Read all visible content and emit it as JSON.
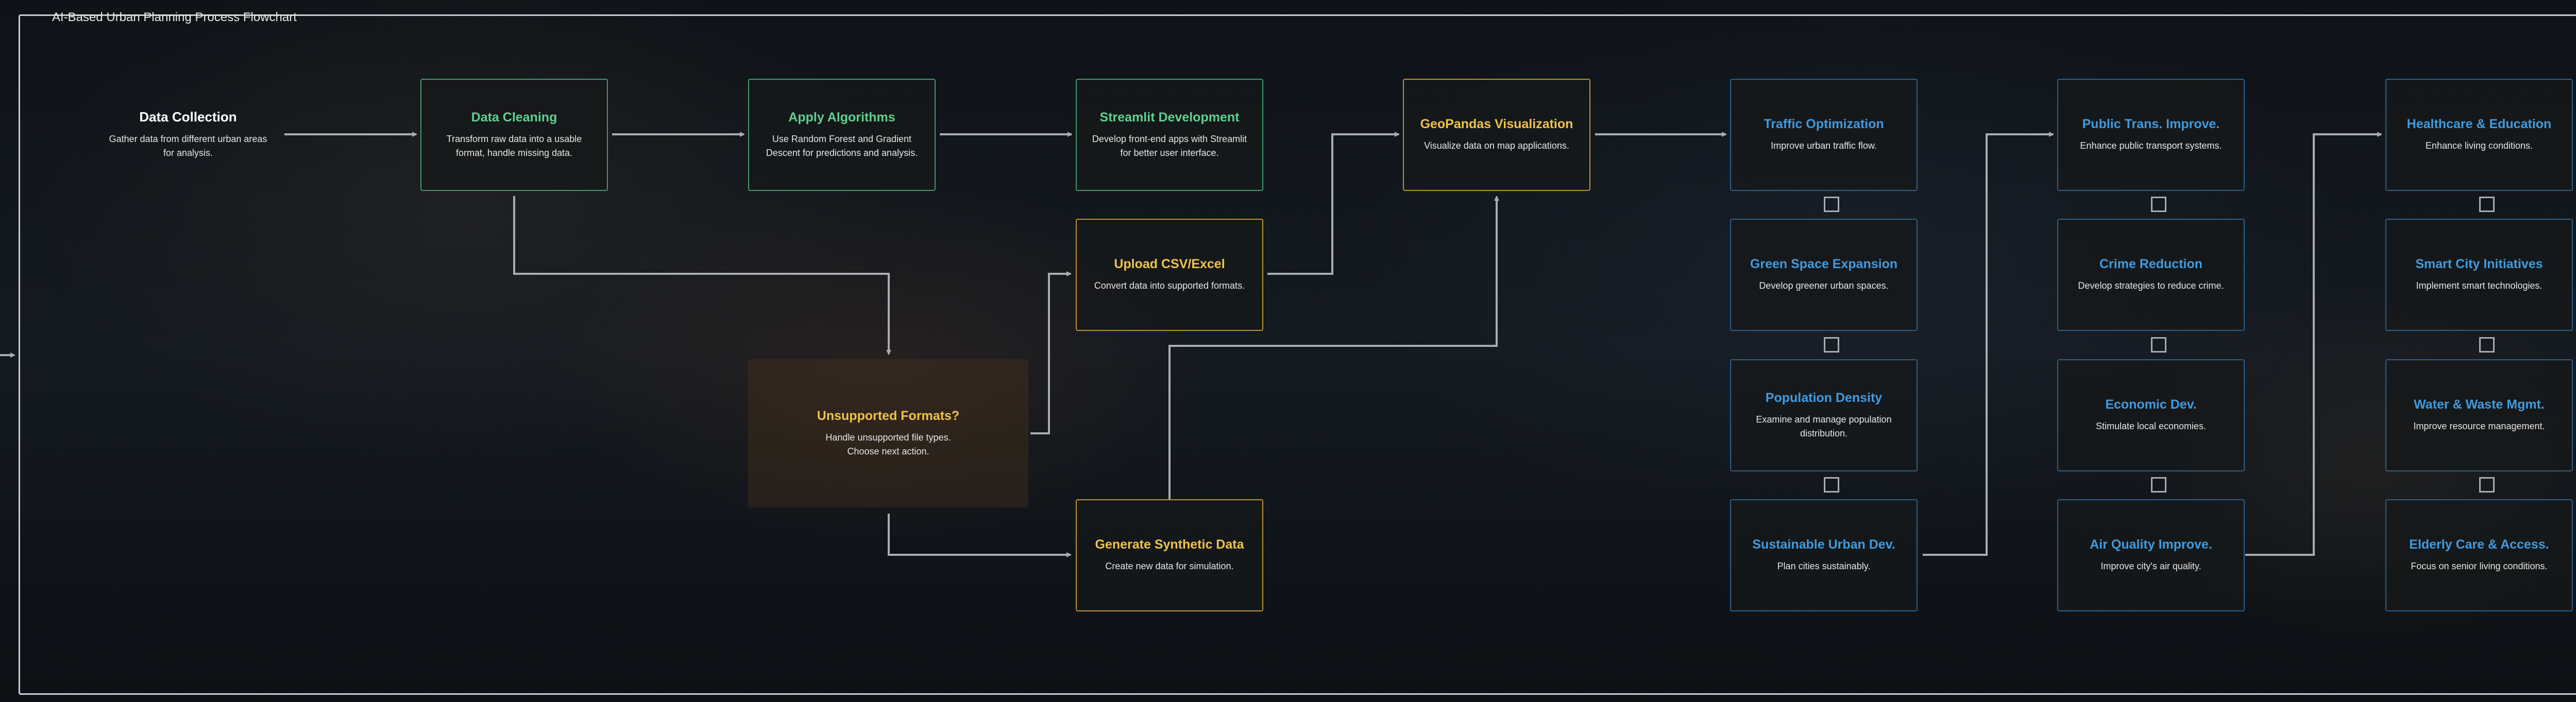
{
  "title": "AI-Based Urban Planning Process Flowchart",
  "nodes": {
    "data_collection": {
      "title": "Data Collection",
      "desc": "Gather data from different urban areas for analysis."
    },
    "data_cleaning": {
      "title": "Data Cleaning",
      "desc": "Transform raw data into a usable format, handle missing data."
    },
    "apply_algorithms": {
      "title": "Apply Algorithms",
      "desc": "Use Random Forest and Gradient Descent for predictions and analysis."
    },
    "streamlit": {
      "title": "Streamlit Development",
      "desc": "Develop front-end apps with Streamlit for better user interface."
    },
    "geopandas": {
      "title": "GeoPandas Visualization",
      "desc": "Visualize data on map applications."
    },
    "upload_csv": {
      "title": "Upload CSV/Excel",
      "desc": "Convert data into supported formats."
    },
    "unsupported": {
      "title": "Unsupported Formats?",
      "desc": "Handle unsupported file types. Choose next action."
    },
    "synthetic": {
      "title": "Generate Synthetic Data",
      "desc": "Create new data for simulation."
    },
    "traffic": {
      "title": "Traffic Optimization",
      "desc": "Improve urban traffic flow."
    },
    "green_space": {
      "title": "Green Space Expansion",
      "desc": "Develop greener urban spaces."
    },
    "population": {
      "title": "Population Density",
      "desc": "Examine and manage population distribution."
    },
    "sustainable": {
      "title": "Sustainable Urban Dev.",
      "desc": "Plan cities sustainably."
    },
    "public_trans": {
      "title": "Public Trans. Improve.",
      "desc": "Enhance public transport systems."
    },
    "crime": {
      "title": "Crime Reduction",
      "desc": "Develop strategies to reduce crime."
    },
    "economic": {
      "title": "Economic Dev.",
      "desc": "Stimulate local economies."
    },
    "air_quality": {
      "title": "Air Quality Improve.",
      "desc": "Improve city's air quality."
    },
    "healthcare": {
      "title": "Healthcare & Education",
      "desc": "Enhance living conditions."
    },
    "smart_city": {
      "title": "Smart City Initiatives",
      "desc": "Implement smart technologies."
    },
    "water_waste": {
      "title": "Water & Waste Mgmt.",
      "desc": "Improve resource management."
    },
    "elderly": {
      "title": "Elderly Care & Access.",
      "desc": "Focus on senior living conditions."
    }
  },
  "colors": {
    "green": "#5fd08f",
    "yellow": "#f0c24b",
    "blue": "#3f9be0",
    "connector": "#a8adb3"
  }
}
